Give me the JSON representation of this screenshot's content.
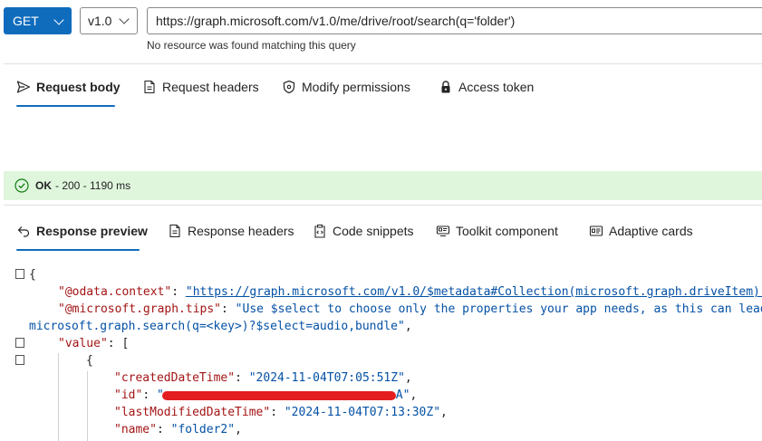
{
  "request": {
    "method": "GET",
    "version": "v1.0",
    "url": "https://graph.microsoft.com/v1.0/me/drive/root/search(q='folder')",
    "url_message": "No resource was found matching this query"
  },
  "request_tabs": [
    {
      "label": "Request body",
      "icon": "send-icon",
      "active": true
    },
    {
      "label": "Request headers",
      "icon": "document-icon",
      "active": false
    },
    {
      "label": "Modify permissions",
      "icon": "shield-icon",
      "active": false
    },
    {
      "label": "Access token",
      "icon": "lock-icon",
      "active": false
    }
  ],
  "status": {
    "ok": "OK",
    "detail": "- 200 - 1190 ms",
    "color": "#dff6dd"
  },
  "response_tabs": [
    {
      "label": "Response preview",
      "icon": "undo-arrow-icon",
      "active": true
    },
    {
      "label": "Response headers",
      "icon": "document-icon",
      "active": false
    },
    {
      "label": "Code snippets",
      "icon": "clipboard-code-icon",
      "active": false
    },
    {
      "label": "Toolkit component",
      "icon": "toolkit-icon",
      "active": false
    },
    {
      "label": "Adaptive cards",
      "icon": "card-icon",
      "active": false
    }
  ],
  "json": {
    "open_brace": "{",
    "context_key": "\"@odata.context\"",
    "context_value": "\"https://graph.microsoft.com/v1.0/$metadata#Collection(microsoft.graph.driveItem)\"",
    "tips_key": "\"@microsoft.graph.tips\"",
    "tips_value_1": "\"Use $select to choose only the properties your app needs, as this can lead",
    "tips_value_2": "microsoft.graph.search(q=<key>)?$select=audio,bundle\"",
    "value_key": "\"value\"",
    "open_bracket": "[",
    "item_open": "{",
    "created_key": "\"createdDateTime\"",
    "created_value": "\"2024-11-04T07:05:51Z\"",
    "id_key": "\"id\"",
    "id_prefix": "\"",
    "id_suffix": "A\"",
    "modified_key": "\"lastModifiedDateTime\"",
    "modified_value": "\"2024-11-04T07:13:30Z\"",
    "name_key": "\"name\"",
    "name_value": "\"folder2\""
  },
  "colors": {
    "accent": "#0f6cbd",
    "json_key": "#a31515",
    "json_string": "#0451a5",
    "redaction": "#e41e1e"
  }
}
